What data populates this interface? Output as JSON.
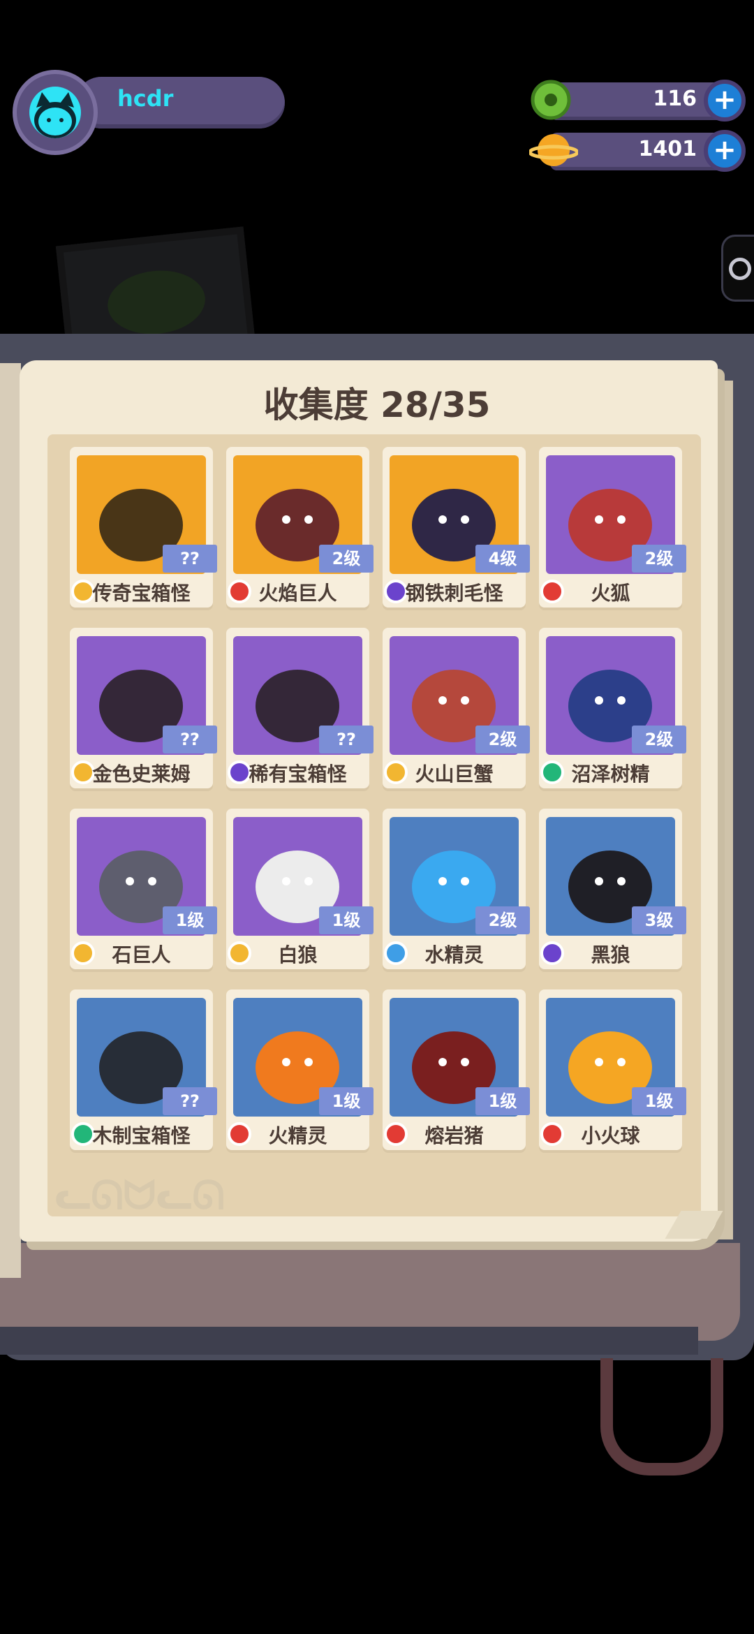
{
  "player": {
    "name": "hcdr"
  },
  "currencies": [
    {
      "name": "gems",
      "icon": "green-donut-icon",
      "value": "116"
    },
    {
      "name": "coins",
      "icon": "planet-coin-icon",
      "value": "1401"
    }
  ],
  "collection": {
    "title": "收集度 28/35"
  },
  "monsters": [
    {
      "name": "传奇宝箱怪",
      "level": "??",
      "element": "gold",
      "bg": "orange",
      "silhouette": true
    },
    {
      "name": "火焰巨人",
      "level": "2级",
      "element": "fire",
      "bg": "orange",
      "silhouette": false
    },
    {
      "name": "钢铁刺毛怪",
      "level": "4级",
      "element": "dark",
      "bg": "orange",
      "silhouette": false
    },
    {
      "name": "火狐",
      "level": "2级",
      "element": "fire",
      "bg": "purple",
      "silhouette": false
    },
    {
      "name": "金色史莱姆",
      "level": "??",
      "element": "gold",
      "bg": "purple",
      "silhouette": true
    },
    {
      "name": "稀有宝箱怪",
      "level": "??",
      "element": "dark",
      "bg": "purple",
      "silhouette": true
    },
    {
      "name": "火山巨蟹",
      "level": "2级",
      "element": "gold",
      "bg": "purple",
      "silhouette": false
    },
    {
      "name": "沼泽树精",
      "level": "2级",
      "element": "nature",
      "bg": "purple",
      "silhouette": false
    },
    {
      "name": "石巨人",
      "level": "1级",
      "element": "gold",
      "bg": "purple",
      "silhouette": false
    },
    {
      "name": "白狼",
      "level": "1级",
      "element": "gold",
      "bg": "purple",
      "silhouette": false
    },
    {
      "name": "水精灵",
      "level": "2级",
      "element": "water",
      "bg": "blue",
      "silhouette": false
    },
    {
      "name": "黑狼",
      "level": "3级",
      "element": "dark",
      "bg": "blue",
      "silhouette": false
    },
    {
      "name": "木制宝箱怪",
      "level": "??",
      "element": "nature",
      "bg": "blue",
      "silhouette": true
    },
    {
      "name": "火精灵",
      "level": "1级",
      "element": "fire",
      "bg": "blue",
      "silhouette": false
    },
    {
      "name": "熔岩猪",
      "level": "1级",
      "element": "fire",
      "bg": "blue",
      "silhouette": false
    },
    {
      "name": "小火球",
      "level": "1级",
      "element": "fire",
      "bg": "blue",
      "silhouette": false
    }
  ],
  "colors": {
    "hud_bar": "#5a4f7d",
    "plus_button": "#1d7fd6",
    "page": "#f3ead5",
    "card_orange": "#f2a425",
    "card_purple": "#8b5ec9",
    "card_blue": "#4e7fc0",
    "level_badge": "#7b8ed6"
  }
}
